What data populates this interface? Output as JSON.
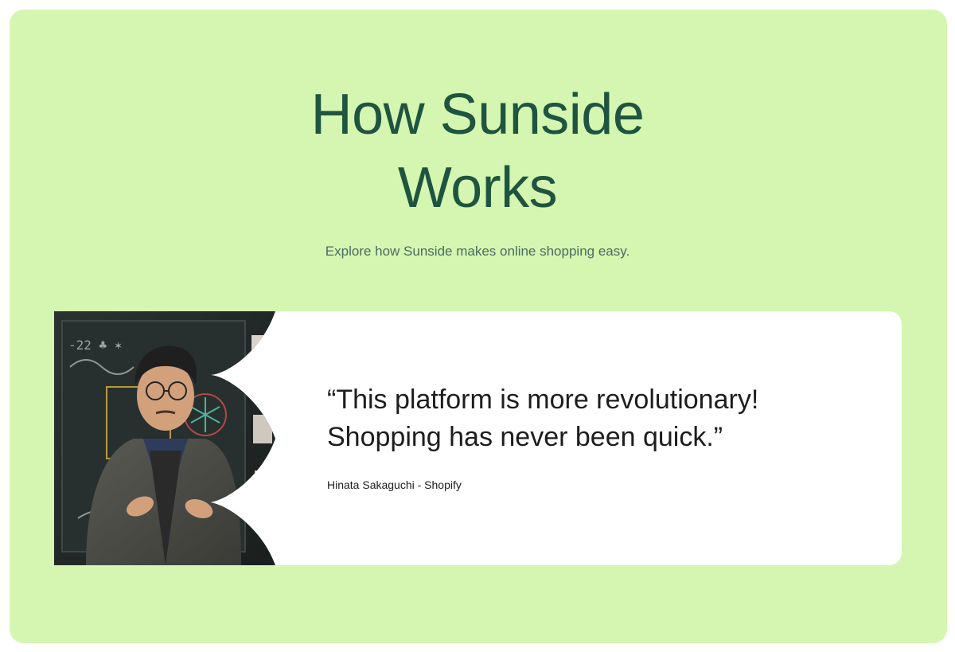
{
  "hero": {
    "title_line1": "How Sunside",
    "title_line2": "Works",
    "subtitle": "Explore how Sunside makes online shopping easy."
  },
  "testimonial": {
    "quote_line1": "“This platform is more revolutionary!",
    "quote_line2": "Shopping has never been quick.”",
    "author": "Hinata Sakaguchi - Shopify",
    "photo_icon": "person-photo-icon"
  },
  "colors": {
    "background_panel": "#d5f6b1",
    "title": "#1f5440",
    "subtitle": "#4b6b62",
    "card": "#ffffff",
    "text": "#1d1d1d"
  }
}
